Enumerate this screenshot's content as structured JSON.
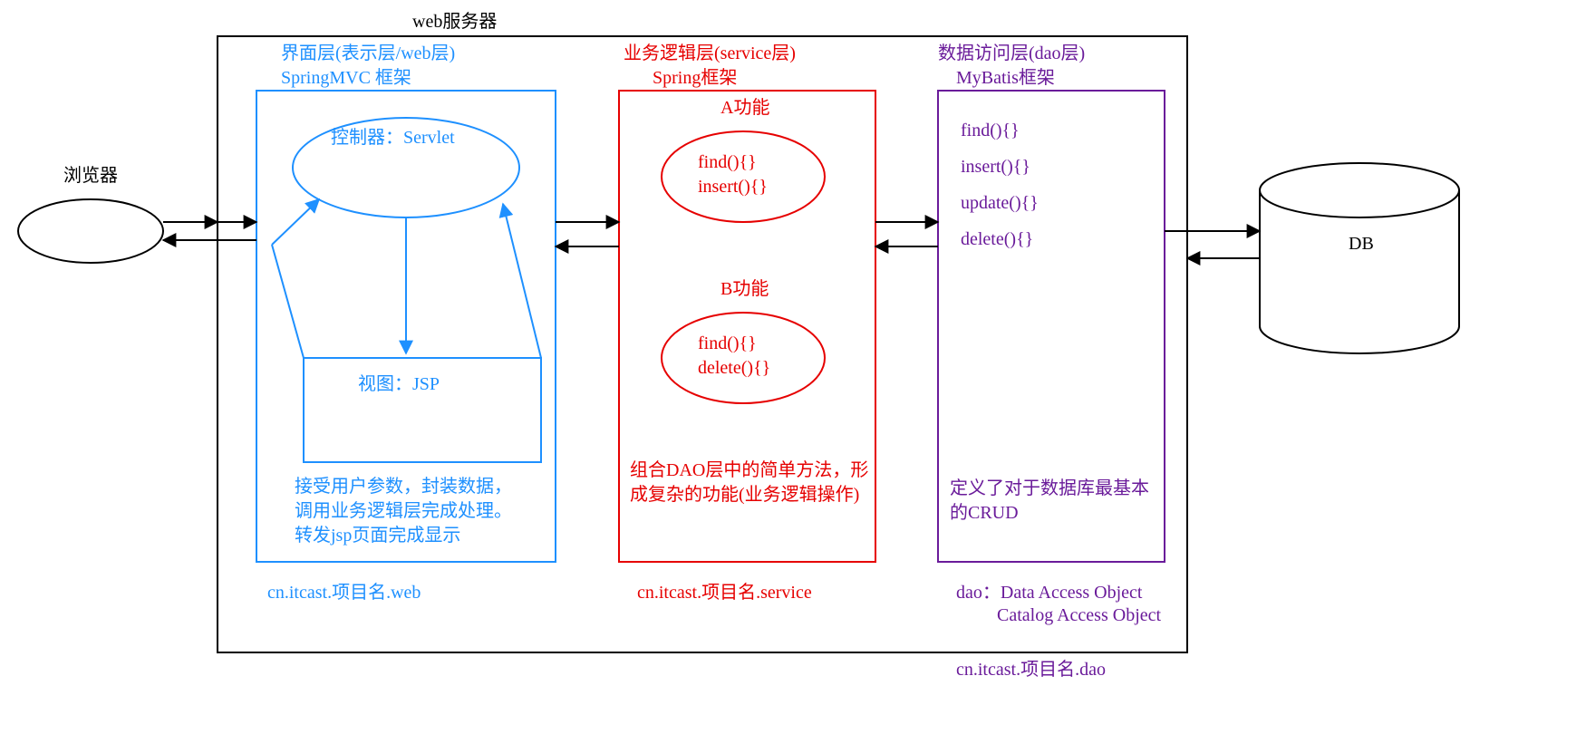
{
  "server_title": "web服务器",
  "browser_label": "浏览器",
  "db_label": "DB",
  "web_layer": {
    "title1": "界面层(表示层/web层)",
    "title2": "SpringMVC 框架",
    "controller": "控制器：Servlet",
    "view": "视图：JSP",
    "desc1": "接受用户参数，封装数据，",
    "desc2": "调用业务逻辑层完成处理。",
    "desc3": "转发jsp页面完成显示",
    "package": "cn.itcast.项目名.web"
  },
  "service_layer": {
    "title1": "业务逻辑层(service层)",
    "title2": "Spring框架",
    "a_title": "A功能",
    "a_m1": "find(){}",
    "a_m2": "insert(){}",
    "b_title": "B功能",
    "b_m1": "find(){}",
    "b_m2": "delete(){}",
    "desc1": "组合DAO层中的简单方法，形",
    "desc2": "成复杂的功能(业务逻辑操作)",
    "package": "cn.itcast.项目名.service"
  },
  "dao_layer": {
    "title1": "数据访问层(dao层)",
    "title2": "MyBatis框架",
    "m1": "find(){}",
    "m2": "insert(){}",
    "m3": "update(){}",
    "m4": "delete(){}",
    "desc1": "定义了对于数据库最基本",
    "desc2": "的CRUD",
    "note1": "dao：Data Access Object",
    "note2": "Catalog Access Object",
    "package": "cn.itcast.项目名.dao"
  }
}
